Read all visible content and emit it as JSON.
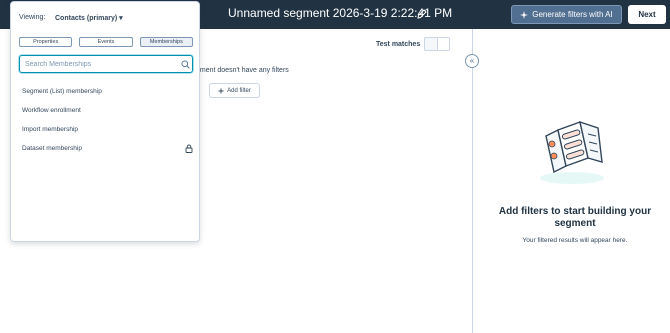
{
  "header": {
    "segment_title": "Unnamed segment 2026-3-19 2:22:41 PM",
    "ai_button_label": "Generate filters with AI",
    "next_button_label": "Next"
  },
  "main": {
    "test_matches_label": "Test matches",
    "no_filters_text": "gment doesn't have any filters",
    "add_filter_label": "Add filter",
    "collapse_glyph": "«"
  },
  "empty_state": {
    "title": "Add filters to start building your segment",
    "subtitle": "Your filtered results will appear here."
  },
  "popover": {
    "viewing_label": "Viewing:",
    "viewing_value": "Contacts (primary) ▾",
    "tabs": [
      {
        "label": "Properties",
        "active": false
      },
      {
        "label": "Events",
        "active": false
      },
      {
        "label": "Memberships",
        "active": true
      }
    ],
    "search": {
      "placeholder": "Search Memberships",
      "value": ""
    },
    "items": [
      {
        "label": "Segment (List) membership",
        "locked": false
      },
      {
        "label": "Workflow enrollment",
        "locked": false
      },
      {
        "label": "Import membership",
        "locked": false
      },
      {
        "label": "Dataset membership",
        "locked": true
      }
    ]
  },
  "colors": {
    "topbar_bg": "#213343",
    "accent": "#0091ae",
    "text": "#33475b"
  },
  "icons": [
    "edit-icon",
    "sparkle-icon",
    "plus-icon",
    "collapse-icon",
    "search-icon",
    "lock-icon",
    "segment-illustration"
  ]
}
